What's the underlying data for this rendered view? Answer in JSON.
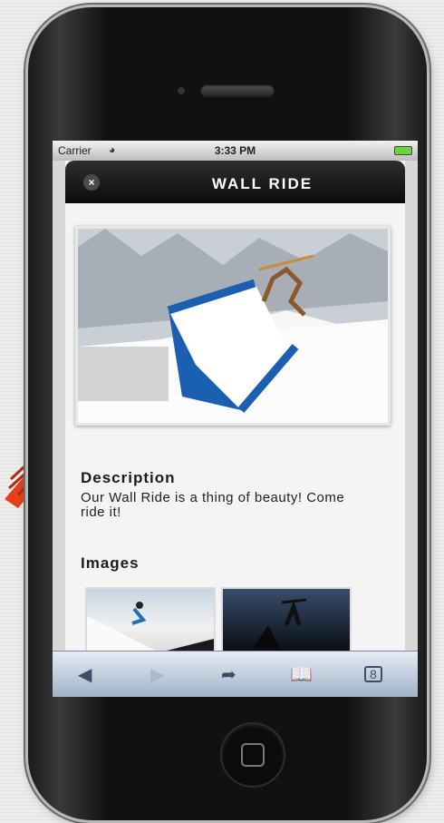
{
  "status_bar": {
    "carrier": "Carrier",
    "time": "3:33 PM"
  },
  "header": {
    "close_label": "×",
    "title": "WALL RIDE"
  },
  "sections": {
    "description_heading": "Description",
    "description_text": "Our Wall Ride is a thing of beauty! Come ride it!",
    "images_heading": "Images"
  },
  "toolbar": {
    "back_icon": "back-arrow-icon",
    "forward_icon": "forward-arrow-icon",
    "share_icon": "share-icon",
    "bookmarks_icon": "bookmarks-icon",
    "tabs_icon": "tabs-icon",
    "tabs_count": "8"
  },
  "colors": {
    "ramp_blue": "#1a5fb0",
    "arrow_red": "#e8401c",
    "title_bar": "#111111"
  }
}
